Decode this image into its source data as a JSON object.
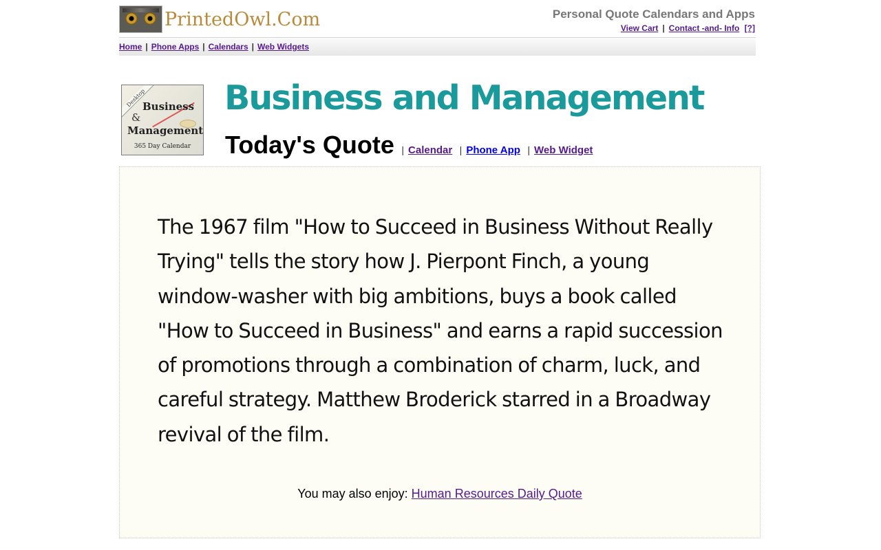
{
  "header": {
    "brand": "PrintedOwl.Com",
    "tagline": "Personal Quote Calendars and Apps",
    "links": [
      "View Cart",
      "Contact -and- Info",
      "[?]"
    ],
    "separator": "|"
  },
  "nav": {
    "items": [
      "Home",
      "Phone Apps",
      "Calendars",
      "Web Widgets"
    ],
    "separator": "|"
  },
  "calendar_image": {
    "corner": "Desktop",
    "line1": "Business",
    "amp": "&",
    "line2": "Management",
    "sub": "365 Day Calendar"
  },
  "title": "Business and Management",
  "quote_section": {
    "heading": "Today's Quote",
    "links": [
      "Calendar",
      "Phone App",
      "Web Widget"
    ],
    "separator": "|"
  },
  "quote": "The 1967 film \"How to Succeed in Business Without Really Trying\" tells the story how J. Pierpont Finch, a young window-washer with big ambitions, buys a book called \"How to Succeed in Business\" and earns a rapid succession of promotions through a combination of charm, luck, and careful strategy. Matthew Broderick starred in a Broadway revival of the film.",
  "also_enjoy": {
    "label": "You may also enjoy:",
    "link": "Human Resources Daily Quote"
  },
  "colors": {
    "title": "#1a9a9a",
    "brand": "#b88a3a",
    "link_visited": "#551a8b",
    "link": "#0000ee",
    "quote_bg": "#fdfdf6"
  }
}
